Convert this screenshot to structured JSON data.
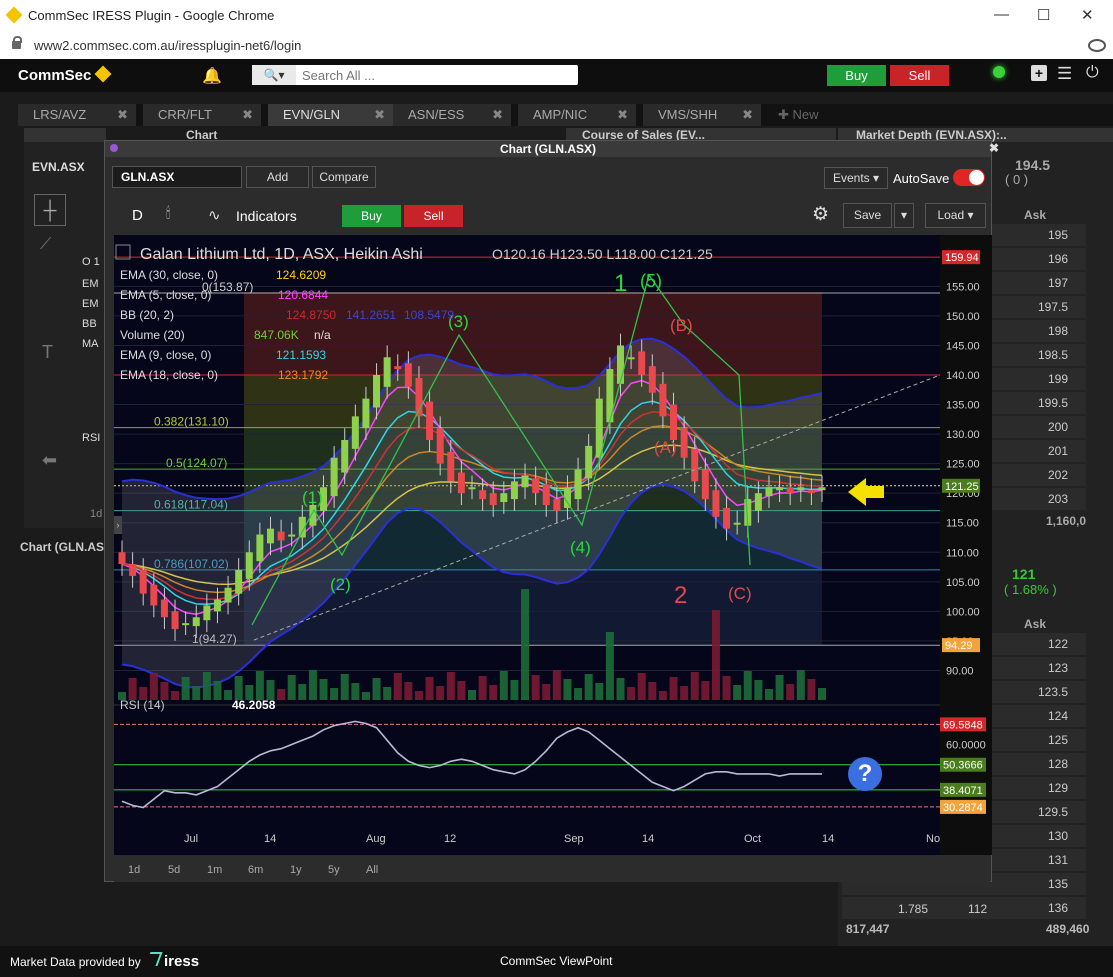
{
  "browser": {
    "title": "CommSec IRESS Plugin - Google Chrome",
    "url": "www2.commsec.com.au/iressplugin-net6/login",
    "minimize": "—",
    "maximize": "☐",
    "close": "✕"
  },
  "app": {
    "logo": "CommSec",
    "search_placeholder": "Search All ...",
    "buy": "Buy",
    "sell": "Sell"
  },
  "tabs": [
    {
      "label": "LRS/AVZ"
    },
    {
      "label": "CRR/FLT"
    },
    {
      "label": "EVN/GLN"
    },
    {
      "label": "ASN/ESS"
    },
    {
      "label": "AMP/NIC"
    },
    {
      "label": "VMS/SHH"
    },
    {
      "label": "✚ New"
    }
  ],
  "panels": {
    "left_title": "Chart (EVN.ASX)",
    "left_code": "EVN.ASX",
    "left_bottom": "Chart (GLN.ASX)",
    "left_snip": [
      "O 1",
      "EM",
      "EM",
      "BB",
      "MA",
      "RSI",
      "1d"
    ],
    "mid_title": "Course of Sales (EV...",
    "right_title": "Market Depth (EVN.ASX):..",
    "right_price": "194.5",
    "right_change": "( 0 )",
    "ask_header": "Ask",
    "ask_rows_top": [
      "195",
      "196",
      "197",
      "197.5",
      "198",
      "198.5",
      "199",
      "199.5",
      "200",
      "201",
      "202",
      "203"
    ],
    "top_total": "1,160,0",
    "right_price2": "121",
    "right_change2": "( 1.68% )",
    "ask_header2": "Ask",
    "ask_rows_bottom": [
      "122",
      "123",
      "123.5",
      "124",
      "125",
      "128",
      "129",
      "129.5",
      "130",
      "131",
      "135",
      "136"
    ],
    "bottom_row": [
      "1.785",
      "112"
    ],
    "totals": [
      "817,447",
      "489,460"
    ]
  },
  "chart_window": {
    "title": "Chart (GLN.ASX)",
    "symbol": "GLN.ASX",
    "add": "Add",
    "compare": "Compare",
    "events": "Events",
    "autosave": "AutoSave",
    "interval": "D",
    "indicators": "Indicators",
    "buy": "Buy",
    "sell": "Sell",
    "save": "Save",
    "load": "Load",
    "ranges": [
      "1d",
      "5d",
      "1m",
      "6m",
      "1y",
      "5y",
      "All"
    ]
  },
  "chart_data": {
    "type": "candlestick",
    "title": "Galan Lithium Ltd, 1D, ASX, Heikin Ashi",
    "ohlc_readout": {
      "O": "120.16",
      "H": "123.50",
      "L": "118.00",
      "C": "121.25"
    },
    "ylim": [
      85,
      162
    ],
    "y_ticks": [
      90,
      95,
      100,
      105,
      110,
      115,
      120,
      125,
      130,
      135,
      140,
      145,
      150,
      155
    ],
    "y_tick_labels": [
      "90.00",
      "95.00",
      "100.00",
      "105.00",
      "110.00",
      "115.00",
      "120.00",
      "125.00",
      "130.00",
      "135.00",
      "140.00",
      "145.00",
      "150.00",
      "155.00"
    ],
    "price_tags": [
      {
        "value": 159.94,
        "label": "159.94",
        "color": "#d62728"
      },
      {
        "value": 121.25,
        "label": "121.25",
        "color": "#4a7d1e"
      },
      {
        "value": 94.29,
        "label": "94.29",
        "color": "#f2a33a"
      }
    ],
    "x_labels": [
      "Jul",
      "14",
      "Aug",
      "12",
      "Sep",
      "14",
      "Oct",
      "14",
      "Nov"
    ],
    "indicators": [
      {
        "name": "EMA (30, close, 0)",
        "value": "124.6209",
        "color": "#ffd400"
      },
      {
        "name": "EMA (5, close, 0)",
        "value": "120.6844",
        "color": "#ff44ff"
      },
      {
        "name": "BB (20, 2)",
        "value": "124.8750",
        "value2": "141.2651",
        "value3": "108.5479",
        "color": "#d62728"
      },
      {
        "name": "Volume (20)",
        "value": "847.06K",
        "value2": "n/a",
        "color": "#6fcf3a"
      },
      {
        "name": "EMA (9, close, 0)",
        "value": "121.1593",
        "color": "#2fd6e8"
      },
      {
        "name": "EMA (18, close, 0)",
        "value": "123.1792",
        "color": "#f28a1a"
      }
    ],
    "fib_levels": [
      {
        "value": 153.87,
        "label": "0(153.87)",
        "color": "#cfcfcf"
      },
      {
        "value": 131.1,
        "label": "0.382(131.10)",
        "color": "#b5c93a"
      },
      {
        "value": 124.07,
        "label": "0.5(124.07)",
        "color": "#6fcf3a"
      },
      {
        "value": 117.04,
        "label": "0.618(117.04)",
        "color": "#44c9a6"
      },
      {
        "value": 107.02,
        "label": "0.786(107.02)",
        "color": "#3aa8d6"
      },
      {
        "value": 94.27,
        "label": "1(94.27)",
        "color": "#cfcfcf"
      }
    ],
    "wave_labels": [
      {
        "text": "1",
        "color": "#29d93a"
      },
      {
        "text": "(5)",
        "color": "#29d93a"
      },
      {
        "text": "(3)",
        "color": "#29d93a"
      },
      {
        "text": "(1)",
        "color": "#29d93a"
      },
      {
        "text": "(2)",
        "color": "#29d93a"
      },
      {
        "text": "(4)",
        "color": "#29d93a"
      },
      {
        "text": "(B)",
        "color": "#e24a4a"
      },
      {
        "text": "(A)",
        "color": "#e24a4a"
      },
      {
        "text": "2",
        "color": "#e24a4a"
      },
      {
        "text": "(C)",
        "color": "#e24a4a"
      }
    ],
    "candles_close": [
      108,
      106,
      103,
      101,
      99,
      97,
      98,
      99,
      101,
      102,
      104,
      107,
      110,
      113,
      114,
      112,
      113,
      116,
      118,
      121,
      126,
      129,
      133,
      136,
      140,
      143,
      141,
      138,
      133,
      129,
      125,
      122,
      120,
      121,
      119,
      118,
      120,
      122,
      123,
      120,
      118,
      117,
      121,
      124,
      128,
      136,
      141,
      145,
      143,
      140,
      137,
      133,
      129,
      126,
      122,
      119,
      116,
      114,
      115,
      119,
      120,
      121,
      121,
      120,
      121,
      120,
      121
    ],
    "rsi": {
      "name": "RSI (14)",
      "value": "46.2058",
      "ylim": [
        25,
        75
      ],
      "tags": [
        {
          "value": 69.5848,
          "label": "69.5848",
          "color": "#d62728"
        },
        {
          "value": 50.3666,
          "label": "50.3666",
          "color": "#4a7d1e"
        },
        {
          "value": 38.4071,
          "label": "38.4071",
          "color": "#4a7d1e"
        },
        {
          "value": 30.2874,
          "label": "30.2874",
          "color": "#f2a33a"
        }
      ],
      "tick": {
        "value": 60,
        "label": "60.0000"
      },
      "values": [
        33,
        31,
        30,
        34,
        38,
        37,
        37,
        36,
        38,
        40,
        44,
        48,
        52,
        55,
        57,
        58,
        60,
        62,
        64,
        67,
        69,
        70,
        71,
        70,
        68,
        62,
        56,
        52,
        50,
        49,
        50,
        52,
        53,
        52,
        50,
        48,
        47,
        46,
        48,
        52,
        57,
        63,
        66,
        68,
        66,
        62,
        58,
        54,
        50,
        46,
        42,
        40,
        38,
        40,
        43,
        46,
        47,
        47,
        46,
        46,
        46,
        46,
        45,
        46,
        46,
        46,
        46
      ]
    }
  },
  "footer": {
    "left": "Market Data provided by",
    "brand": "iress",
    "center": "CommSec ViewPoint"
  },
  "colors": {
    "up": "#8fd14f",
    "down": "#e9484c",
    "accent_yellow": "#f5e000",
    "help_blue": "#3b6fe0"
  }
}
